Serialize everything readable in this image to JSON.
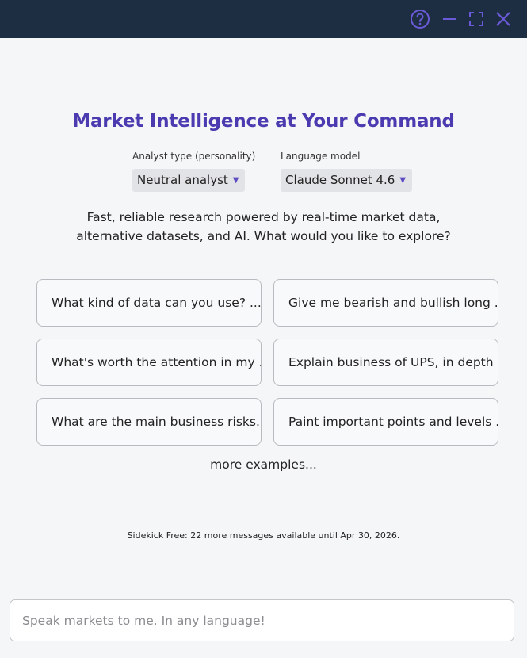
{
  "window": {
    "controls": [
      {
        "name": "help-icon",
        "color": "#6a5ad8"
      },
      {
        "name": "minimize-icon",
        "color": "#6a5ad8"
      },
      {
        "name": "maximize-icon",
        "color": "#6a5ad8"
      },
      {
        "name": "close-icon",
        "color": "#6a5ad8"
      }
    ],
    "titlebar_color": "#1e2e42"
  },
  "headline": "Market Intelligence at Your Command",
  "headline_color": "#4a3bb0",
  "selectors": {
    "analyst": {
      "label": "Analyst type (personality)",
      "value": "Neutral analyst"
    },
    "model": {
      "label": "Language model",
      "value": "Claude Sonnet 4.6"
    }
  },
  "intro": {
    "line1": "Fast, reliable research powered by real-time market data,",
    "line2": "alternative datasets, and AI. What would you like to explore?"
  },
  "examples": [
    "What kind of data can you use? ...",
    "Give me bearish and bullish long ...",
    "What's worth the attention in my ...",
    "Explain business of UPS, in depth",
    "What are the main business risks...",
    "Paint important points and levels ..."
  ],
  "more_examples": "more examples...",
  "quota_text": "Sidekick Free: 22 more messages available until Apr 30, 2026.",
  "chat": {
    "placeholder": "Speak markets to me. In any language!",
    "value": ""
  }
}
